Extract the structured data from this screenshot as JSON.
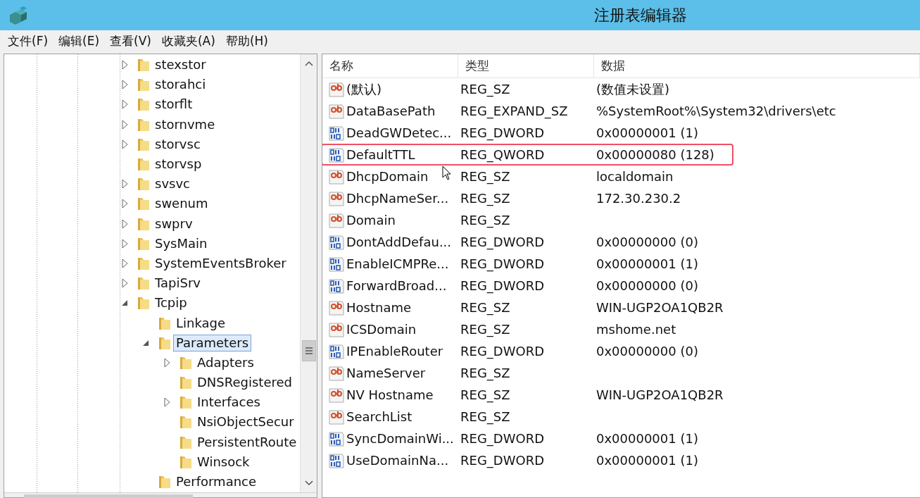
{
  "window": {
    "title": "注册表编辑器"
  },
  "menu": [
    "文件(F)",
    "编辑(E)",
    "查看(V)",
    "收藏夹(A)",
    "帮助(H)"
  ],
  "tree": [
    {
      "label": "stexstor",
      "kind": "branch",
      "expanded": false,
      "selected": false
    },
    {
      "label": "storahci",
      "kind": "branch",
      "expanded": false,
      "selected": false
    },
    {
      "label": "storflt",
      "kind": "branch",
      "expanded": false,
      "selected": false
    },
    {
      "label": "stornvme",
      "kind": "branch",
      "expanded": false,
      "selected": false
    },
    {
      "label": "storvsc",
      "kind": "branch",
      "expanded": false,
      "selected": false
    },
    {
      "label": "storvsp",
      "kind": "leaf",
      "selected": false
    },
    {
      "label": "svsvc",
      "kind": "branch",
      "expanded": false,
      "selected": false
    },
    {
      "label": "swenum",
      "kind": "branch",
      "expanded": false,
      "selected": false
    },
    {
      "label": "swprv",
      "kind": "branch",
      "expanded": false,
      "selected": false
    },
    {
      "label": "SysMain",
      "kind": "branch",
      "expanded": false,
      "selected": false
    },
    {
      "label": "SystemEventsBroker",
      "kind": "branch",
      "expanded": false,
      "selected": false
    },
    {
      "label": "TapiSrv",
      "kind": "branch",
      "expanded": false,
      "selected": false
    },
    {
      "label": "Tcpip",
      "kind": "branch",
      "expanded": true,
      "selected": false,
      "children": [
        {
          "label": "Linkage",
          "kind": "leaf",
          "selected": false
        },
        {
          "label": "Parameters",
          "kind": "branch",
          "expanded": true,
          "selected": true,
          "children": [
            {
              "label": "Adapters",
              "kind": "branch",
              "expanded": false,
              "selected": false
            },
            {
              "label": "DNSRegistered",
              "kind": "leaf",
              "selected": false
            },
            {
              "label": "Interfaces",
              "kind": "branch",
              "expanded": false,
              "selected": false
            },
            {
              "label": "NsiObjectSecur",
              "kind": "leaf",
              "selected": false
            },
            {
              "label": "PersistentRoute",
              "kind": "leaf",
              "selected": false
            },
            {
              "label": "Winsock",
              "kind": "leaf",
              "selected": false
            }
          ]
        },
        {
          "label": "Performance",
          "kind": "leaf",
          "selected": false
        }
      ]
    }
  ],
  "table": {
    "columns": [
      "名称",
      "类型",
      "数据"
    ],
    "rows": [
      {
        "kind": "string",
        "name": "(默认)",
        "type": "REG_SZ",
        "data": "(数值未设置)",
        "highlighted": false
      },
      {
        "kind": "string",
        "name": "DataBasePath",
        "type": "REG_EXPAND_SZ",
        "data": "%SystemRoot%\\System32\\drivers\\etc",
        "highlighted": false
      },
      {
        "kind": "binary",
        "name": "DeadGWDetec...",
        "type": "REG_DWORD",
        "data": "0x00000001 (1)",
        "highlighted": false
      },
      {
        "kind": "binary",
        "name": "DefaultTTL",
        "type": "REG_QWORD",
        "data": "0x00000080 (128)",
        "highlighted": true
      },
      {
        "kind": "string",
        "name": "DhcpDomain",
        "type": "REG_SZ",
        "data": "localdomain",
        "highlighted": false
      },
      {
        "kind": "string",
        "name": "DhcpNameSer...",
        "type": "REG_SZ",
        "data": "172.30.230.2",
        "highlighted": false
      },
      {
        "kind": "string",
        "name": "Domain",
        "type": "REG_SZ",
        "highlighted": false
      },
      {
        "kind": "binary",
        "name": "DontAddDefau...",
        "type": "REG_DWORD",
        "data": "0x00000000 (0)",
        "highlighted": false
      },
      {
        "kind": "binary",
        "name": "EnableICMPRe...",
        "type": "REG_DWORD",
        "data": "0x00000001 (1)",
        "highlighted": false
      },
      {
        "kind": "binary",
        "name": "ForwardBroad...",
        "type": "REG_DWORD",
        "data": "0x00000000 (0)",
        "highlighted": false
      },
      {
        "kind": "string",
        "name": "Hostname",
        "type": "REG_SZ",
        "data": "WIN-UGP2OA1QB2R",
        "highlighted": false
      },
      {
        "kind": "string",
        "name": "ICSDomain",
        "type": "REG_SZ",
        "data": "mshome.net",
        "highlighted": false
      },
      {
        "kind": "binary",
        "name": "IPEnableRouter",
        "type": "REG_DWORD",
        "data": "0x00000000 (0)",
        "highlighted": false
      },
      {
        "kind": "string",
        "name": "NameServer",
        "type": "REG_SZ",
        "highlighted": false
      },
      {
        "kind": "string",
        "name": "NV Hostname",
        "type": "REG_SZ",
        "data": "WIN-UGP2OA1QB2R",
        "highlighted": false
      },
      {
        "kind": "string",
        "name": "SearchList",
        "type": "REG_SZ",
        "highlighted": false
      },
      {
        "kind": "binary",
        "name": "SyncDomainWi...",
        "type": "REG_DWORD",
        "data": "0x00000001 (1)",
        "highlighted": false
      },
      {
        "kind": "binary",
        "name": "UseDomainNa...",
        "type": "REG_DWORD",
        "data": "0x00000001 (1)",
        "highlighted": false
      }
    ]
  }
}
